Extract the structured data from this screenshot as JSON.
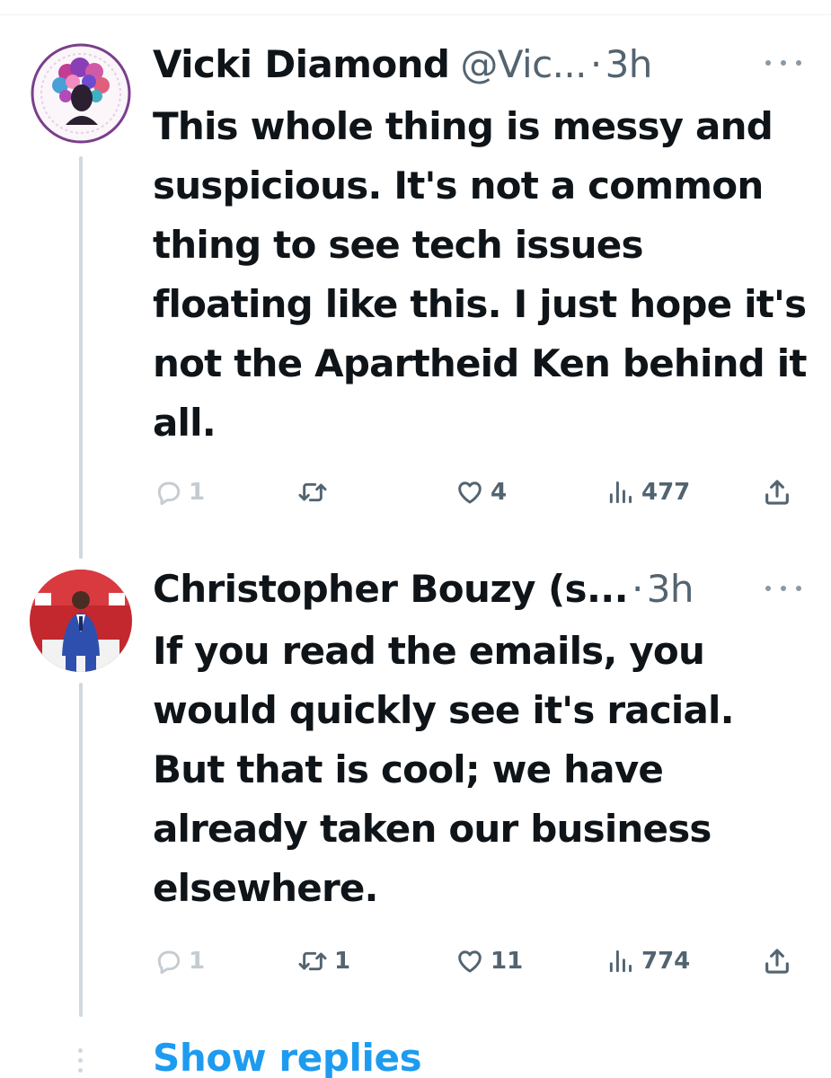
{
  "tweets": [
    {
      "display_name": "Vicki Diamond",
      "handle": "@Vic...",
      "separator": "·",
      "time": "3h",
      "text": "This whole thing is messy and suspicious. It's not a common thing to see tech issues floating like this. I just hope it's not the Apartheid Ken behind it all.",
      "replies": "1",
      "retweets": "",
      "likes": "4",
      "views": "477"
    },
    {
      "display_name": "Christopher Bouzy (s...",
      "separator": "·",
      "time": "3h",
      "text": "If you read the emails, you would quickly see it's racial. But that is cool; we have already taken our business elsewhere.",
      "replies": "1",
      "retweets": "1",
      "likes": "11",
      "views": "774"
    }
  ],
  "show_replies_label": "Show replies",
  "colors": {
    "text": "#0f1419",
    "secondary": "#536471",
    "link": "#1d9bf0",
    "thread_line": "#cfd9de"
  },
  "icons": {
    "reply": "speech-bubble-icon",
    "retweet": "retweet-arrows-icon",
    "like": "heart-outline-icon",
    "views": "bar-chart-icon",
    "share": "upload-arrow-icon",
    "more": "horizontal-ellipsis-icon"
  }
}
